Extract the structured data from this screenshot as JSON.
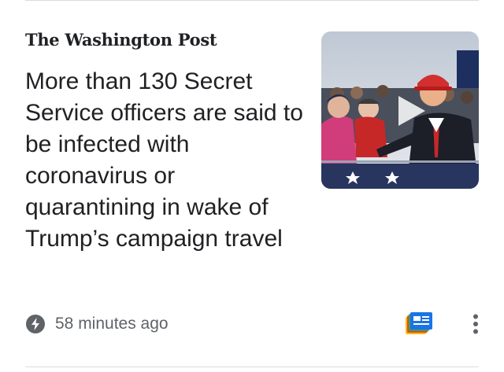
{
  "article": {
    "publisher": "The Washington Post",
    "headline": "More than 130 Secret Service officers are said to be infected with coronavirus or quarantining in wake of Trump’s campaign travel",
    "timestamp": "58 minutes ago",
    "thumbnail_icon": "play-icon",
    "timestamp_icon": "bolt-icon"
  },
  "actions": {
    "newsstand_icon": "newsstand-icon",
    "more_icon": "more-vert-icon"
  },
  "colors": {
    "text_primary": "#202124",
    "text_secondary": "#5f6368",
    "divider": "#dadce0",
    "icon_blue": "#1a73e8",
    "icon_red": "#ea4335",
    "icon_yellow": "#fbbc04",
    "icon_green": "#34a853"
  }
}
